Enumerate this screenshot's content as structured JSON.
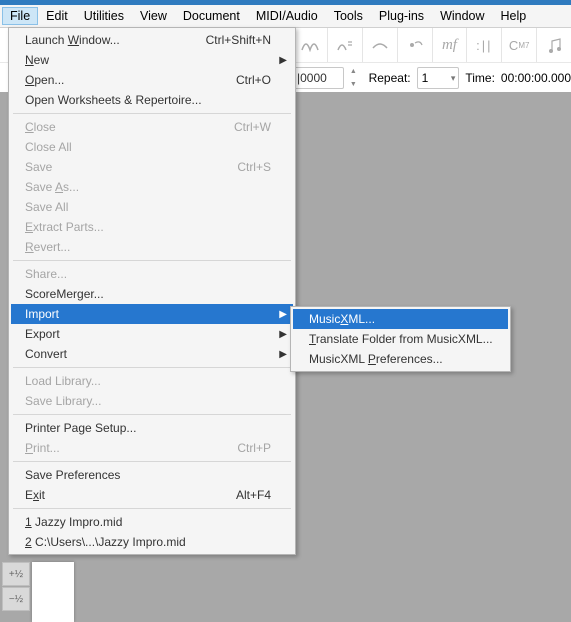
{
  "menu_bar": {
    "items": [
      "File",
      "Edit",
      "Utilities",
      "View",
      "Document",
      "MIDI/Audio",
      "Tools",
      "Plug-ins",
      "Window",
      "Help"
    ]
  },
  "toolbar": {
    "field_value": "|0000",
    "repeat_label": "Repeat:",
    "repeat_value": "1",
    "time_label": "Time:",
    "time_value": "00:00:00.000"
  },
  "ruler": {
    "plus": "+½",
    "minus": "−½"
  },
  "file_menu": {
    "launch_window": "Launch Window...",
    "launch_window_sc": "Ctrl+Shift+N",
    "new": "New",
    "open": "Open...",
    "open_sc": "Ctrl+O",
    "open_wr": "Open Worksheets & Repertoire...",
    "close": "Close",
    "close_sc": "Ctrl+W",
    "close_all": "Close All",
    "save": "Save",
    "save_sc": "Ctrl+S",
    "save_as": "Save As...",
    "save_all": "Save All",
    "extract": "Extract Parts...",
    "revert": "Revert...",
    "share": "Share...",
    "scoremerger": "ScoreMerger...",
    "import": "Import",
    "export": "Export",
    "convert": "Convert",
    "load_lib": "Load Library...",
    "save_lib": "Save Library...",
    "page_setup": "Printer Page Setup...",
    "print": "Print...",
    "print_sc": "Ctrl+P",
    "save_prefs": "Save Preferences",
    "exit": "Exit",
    "exit_sc": "Alt+F4",
    "recent1_prefix": "1",
    "recent1_label": " Jazzy Impro.mid",
    "recent2_prefix": "2",
    "recent2_label": " C:\\Users\\...\\Jazzy Impro.mid"
  },
  "import_submenu": {
    "musicxml": "MusicXML...",
    "translate": "Translate Folder from MusicXML...",
    "prefs": "MusicXML Preferences..."
  }
}
